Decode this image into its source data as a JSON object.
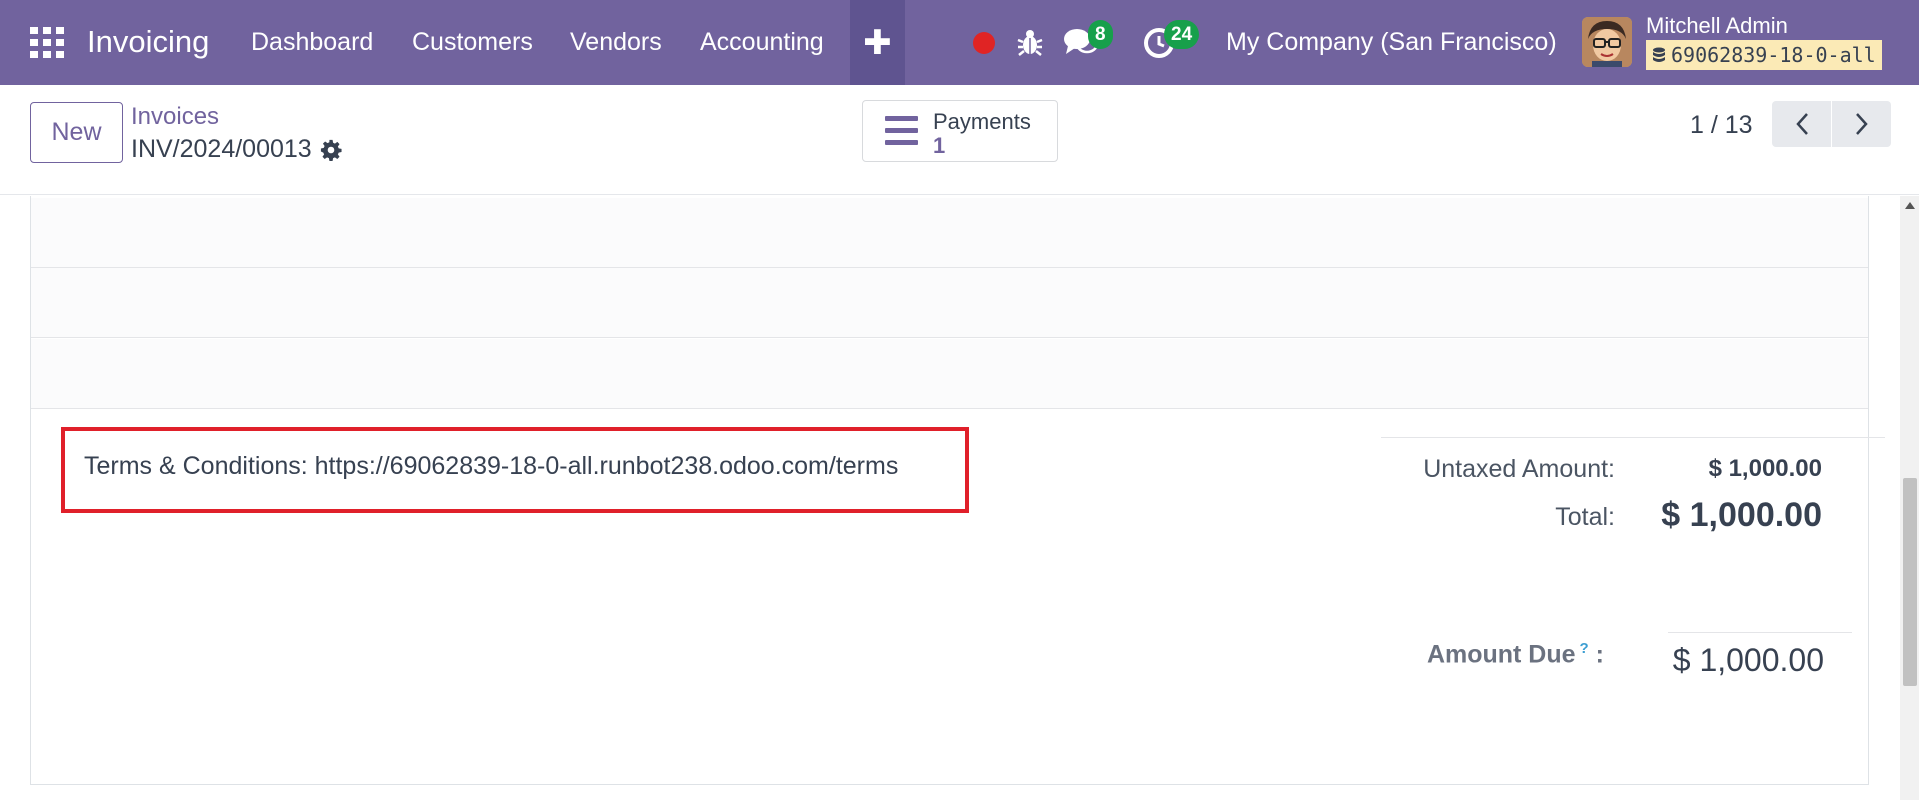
{
  "navbar": {
    "app_name": "Invoicing",
    "menu": [
      "Dashboard",
      "Customers",
      "Vendors",
      "Accounting"
    ],
    "messages_count": "8",
    "activities_count": "24",
    "company": "My Company (San Francisco)",
    "user_name": "Mitchell Admin",
    "database": "69062839-18-0-all"
  },
  "control_panel": {
    "new_label": "New",
    "breadcrumb_parent": "Invoices",
    "record_name": "INV/2024/00013",
    "payments_label": "Payments",
    "payments_count": "1",
    "pager": "1 / 13"
  },
  "form": {
    "terms": "Terms & Conditions: https://69062839-18-0-all.runbot238.odoo.com/terms",
    "totals": {
      "untaxed_label": "Untaxed Amount:",
      "untaxed_value": "$ 1,000.00",
      "total_label": "Total:",
      "total_value": "$ 1,000.00",
      "amount_due_label": "Amount Due",
      "amount_due_help": "?",
      "amount_due_colon": ":",
      "amount_due_value": "$ 1,000.00"
    }
  },
  "colors": {
    "brand": "#71639e",
    "badge": "#17a04b",
    "highlight": "#e0202a"
  }
}
